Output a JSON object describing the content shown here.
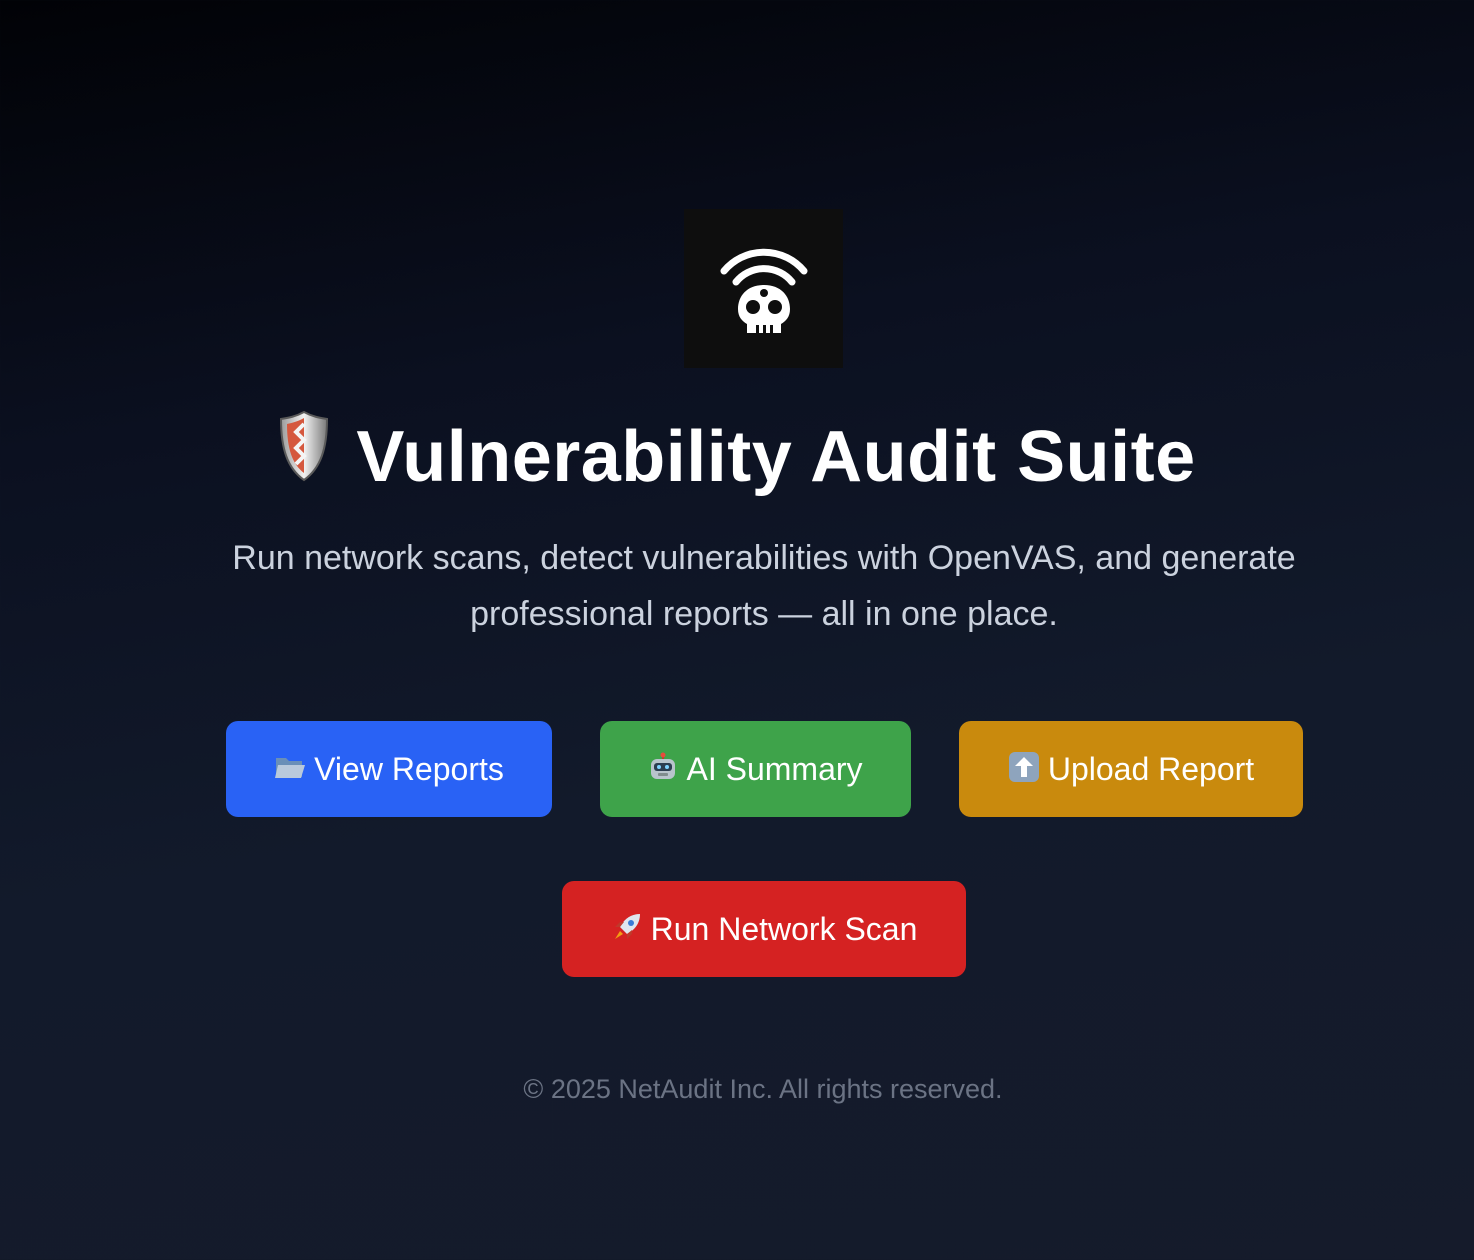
{
  "hero": {
    "logo_icon": "wifi-skull-icon",
    "title_icon": "shield-icon",
    "title": "Vulnerability Audit Suite",
    "subtitle": "Run network scans, detect vulnerabilities with OpenVAS, and generate professional reports — all in one place."
  },
  "actions": {
    "view_reports": {
      "icon": "folder-icon",
      "label": "View Reports",
      "color": "#2962f5"
    },
    "ai_summary": {
      "icon": "robot-icon",
      "label": "AI Summary",
      "color": "#3ea34a"
    },
    "upload_report": {
      "icon": "up-arrow-icon",
      "label": "Upload Report",
      "color": "#c98a0d"
    },
    "run_scan": {
      "icon": "rocket-icon",
      "label": "Run Network Scan",
      "color": "#d52222"
    }
  },
  "footer": {
    "copyright": "© 2025 NetAudit Inc. All rights reserved."
  }
}
